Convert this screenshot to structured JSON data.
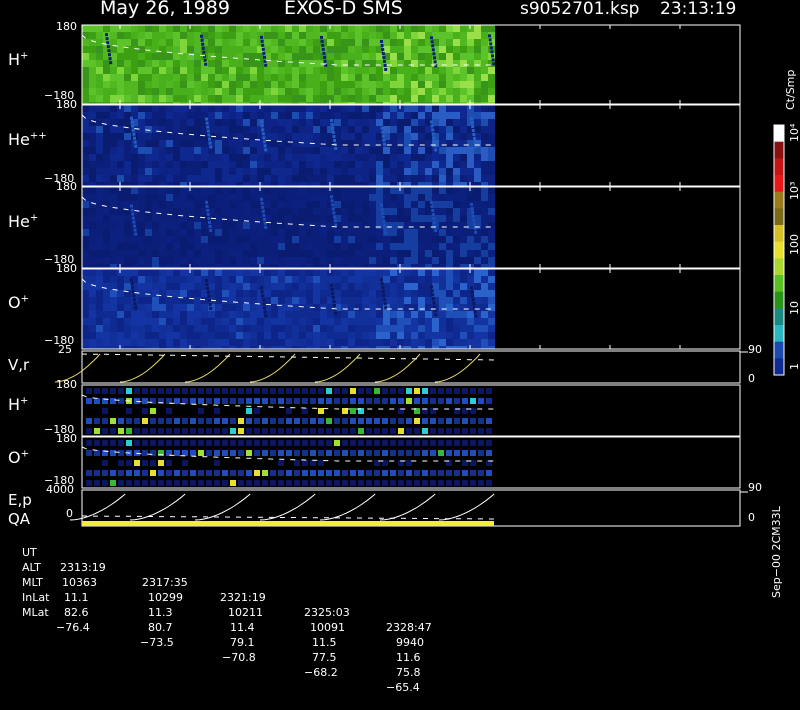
{
  "header": {
    "date": "May 26, 1989",
    "instrument": "EXOS-D SMS",
    "file": "s9052701.ksp",
    "time": "23:13:19"
  },
  "panels": [
    {
      "label": "H",
      "sup": "+",
      "top": "180",
      "bottom": "−180",
      "color": "green"
    },
    {
      "label": "He",
      "sup": "++",
      "top": "180",
      "bottom": "−180",
      "color": "navy"
    },
    {
      "label": "He",
      "sup": "+",
      "top": "180",
      "bottom": "−180",
      "color": "navy"
    },
    {
      "label": "O",
      "sup": "+",
      "top": "180",
      "bottom": "−180",
      "color": "blue"
    }
  ],
  "vr_panel": {
    "label": "V,r",
    "top": "25",
    "right_top": "90",
    "right_bottom": "0"
  },
  "small_panels": [
    {
      "label": "H",
      "sup": "+",
      "top": "180",
      "bottom": "−180"
    },
    {
      "label": "O",
      "sup": "+",
      "top": "180",
      "bottom": "−180"
    }
  ],
  "ep_panel": {
    "label": "E,p",
    "label2": "QA",
    "top": "4000",
    "mid": "0",
    "right_top": "90",
    "right_bottom": "0"
  },
  "colorbar": {
    "title": "Ct/Smp",
    "ticks": [
      "10⁴",
      "10³",
      "100",
      "10",
      "1"
    ]
  },
  "table": {
    "rows": [
      {
        "name": "UT",
        "values": [
          "2313:19",
          "2317:35",
          "2321:19",
          "2325:03",
          "2328:47"
        ]
      },
      {
        "name": "ALT",
        "values": [
          "10363",
          "10299",
          "10211",
          "10091",
          "9940"
        ]
      },
      {
        "name": "MLT",
        "values": [
          "11.1",
          "11.3",
          "11.4",
          "11.5",
          "11.6"
        ]
      },
      {
        "name": "InLat",
        "values": [
          "82.6",
          "80.7",
          "79.1",
          "77.5",
          "75.8"
        ]
      },
      {
        "name": "MLat",
        "values": [
          "−76.4",
          "−73.5",
          "−70.8",
          "−68.2",
          "−65.4"
        ]
      }
    ]
  },
  "footer_note": "Sep−00 2CM33L",
  "chart_data": {
    "type": "heatmap",
    "title": "May 26, 1989   EXOS-D SMS",
    "x": [
      "2313:19",
      "2317:35",
      "2321:19",
      "2325:03",
      "2328:47"
    ],
    "panels": [
      "H+",
      "He++",
      "He+",
      "O+",
      "V,r",
      "H+",
      "O+",
      "E,p / QA"
    ],
    "ylim": [
      -180,
      180
    ],
    "colorbar_range": [
      "1",
      "10⁴"
    ],
    "colorbar_label": "Ct/Smp"
  }
}
